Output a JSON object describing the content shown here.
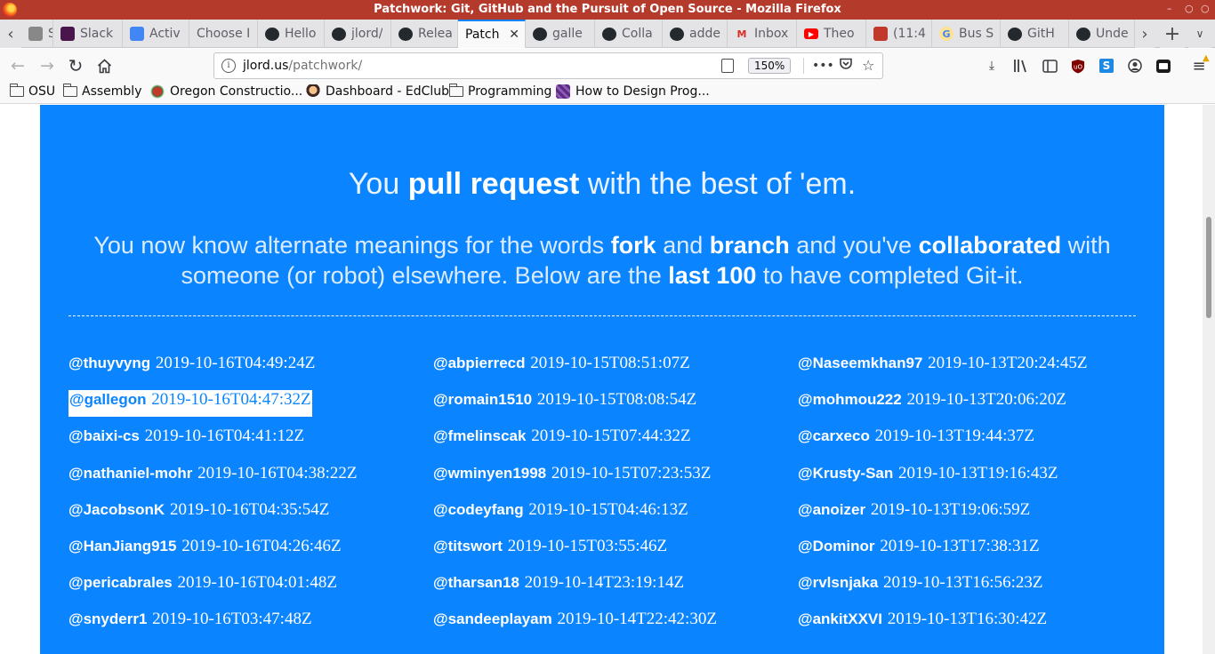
{
  "window": {
    "title": "Patchwork: Git, GitHub and the Pursuit of Open Source - Mozilla Firefox",
    "controls": [
      "–",
      "○",
      "○"
    ]
  },
  "tabs": [
    {
      "label": "S F",
      "icon": "generic-page-icon",
      "color": "#888888"
    },
    {
      "label": "Slack",
      "icon": "slack-icon",
      "color": "#4a154b"
    },
    {
      "label": "Activ",
      "icon": "docs-icon",
      "color": "#4285f4"
    },
    {
      "label": "Choose I",
      "icon": "none",
      "color": ""
    },
    {
      "label": "Hello",
      "icon": "github-icon",
      "color": "#24292e"
    },
    {
      "label": "jlord/",
      "icon": "github-icon",
      "color": "#24292e"
    },
    {
      "label": "Relea",
      "icon": "github-icon",
      "color": "#24292e"
    },
    {
      "label": "Patch",
      "icon": "patchwork-icon",
      "color": "",
      "active": true
    },
    {
      "label": "galle",
      "icon": "github-icon",
      "color": "#24292e"
    },
    {
      "label": "Colla",
      "icon": "github-icon",
      "color": "#24292e"
    },
    {
      "label": "adde",
      "icon": "github-icon",
      "color": "#24292e"
    },
    {
      "label": "Inbox",
      "icon": "gmail-icon",
      "color": "#d93025"
    },
    {
      "label": "Theo",
      "icon": "youtube-icon",
      "color": "#ff0000"
    },
    {
      "label": "(11:4",
      "icon": "mascot-icon",
      "color": "#c0392b"
    },
    {
      "label": "Bus S",
      "icon": "google-icon",
      "color": "#f4b400"
    },
    {
      "label": "GitH",
      "icon": "github-icon",
      "color": "#24292e"
    },
    {
      "label": "Unde",
      "icon": "github-icon",
      "color": "#24292e"
    }
  ],
  "nav": {
    "url_host": "jlord.us",
    "url_path": "/patchwork/",
    "zoom": "150%",
    "page_actions": "•••"
  },
  "bookmarks": [
    {
      "label": "OSU",
      "icon": "folder-icon"
    },
    {
      "label": "Assembly",
      "icon": "folder-icon"
    },
    {
      "label": "Oregon Constructio...",
      "icon": "oregon-icon"
    },
    {
      "label": "Dashboard - EdClub",
      "icon": "edclub-icon"
    },
    {
      "label": "Programming",
      "icon": "folder-icon"
    },
    {
      "label": "How to Design Prog...",
      "icon": "htdp-icon"
    }
  ],
  "content": {
    "headline": {
      "pre": "You ",
      "bold": "pull request",
      "post": " with the best of 'em."
    },
    "sub": {
      "p1": "You now know alternate meanings for the words ",
      "b1": "fork",
      "p2": " and ",
      "b2": "branch",
      "p3": " and you've ",
      "b3": "collaborated",
      "p4": " with someone (or robot) elsewhere. Below are the ",
      "b4": "last 100",
      "p5": " to have completed Git-it."
    },
    "columns": [
      [
        {
          "user": "@thuyvyng",
          "ts": "2019-10-16T04:49:24Z"
        },
        {
          "user": "@gallegon",
          "ts": "2019-10-16T04:47:32Z",
          "selected": true
        },
        {
          "user": "@baixi-cs",
          "ts": "2019-10-16T04:41:12Z"
        },
        {
          "user": "@nathaniel-mohr",
          "ts": "2019-10-16T04:38:22Z"
        },
        {
          "user": "@JacobsonK",
          "ts": "2019-10-16T04:35:54Z"
        },
        {
          "user": "@HanJiang915",
          "ts": "2019-10-16T04:26:46Z"
        },
        {
          "user": "@pericabrales",
          "ts": "2019-10-16T04:01:48Z"
        },
        {
          "user": "@snyderr1",
          "ts": "2019-10-16T03:47:48Z"
        }
      ],
      [
        {
          "user": "@abpierrecd",
          "ts": "2019-10-15T08:51:07Z"
        },
        {
          "user": "@romain1510",
          "ts": "2019-10-15T08:08:54Z"
        },
        {
          "user": "@fmelinscak",
          "ts": "2019-10-15T07:44:32Z"
        },
        {
          "user": "@wminyen1998",
          "ts": "2019-10-15T07:23:53Z"
        },
        {
          "user": "@codeyfang",
          "ts": "2019-10-15T04:46:13Z"
        },
        {
          "user": "@titswort",
          "ts": "2019-10-15T03:55:46Z"
        },
        {
          "user": "@tharsan18",
          "ts": "2019-10-14T23:19:14Z"
        },
        {
          "user": "@sandeeplayam",
          "ts": "2019-10-14T22:42:30Z"
        }
      ],
      [
        {
          "user": "@Naseemkhan97",
          "ts": "2019-10-13T20:24:45Z"
        },
        {
          "user": "@mohmou222",
          "ts": "2019-10-13T20:06:20Z"
        },
        {
          "user": "@carxeco",
          "ts": "2019-10-13T19:44:37Z"
        },
        {
          "user": "@Krusty-San",
          "ts": "2019-10-13T19:16:43Z"
        },
        {
          "user": "@anoizer",
          "ts": "2019-10-13T19:06:59Z"
        },
        {
          "user": "@Dominor",
          "ts": "2019-10-13T17:38:31Z"
        },
        {
          "user": "@rvlsnjaka",
          "ts": "2019-10-13T16:56:23Z"
        },
        {
          "user": "@ankitXXVI",
          "ts": "2019-10-13T16:30:42Z"
        }
      ]
    ]
  },
  "colors": {
    "panel": "#0a84ff",
    "title_bar": "#b43a2c",
    "active_tab_accent": "#0a84ff"
  }
}
